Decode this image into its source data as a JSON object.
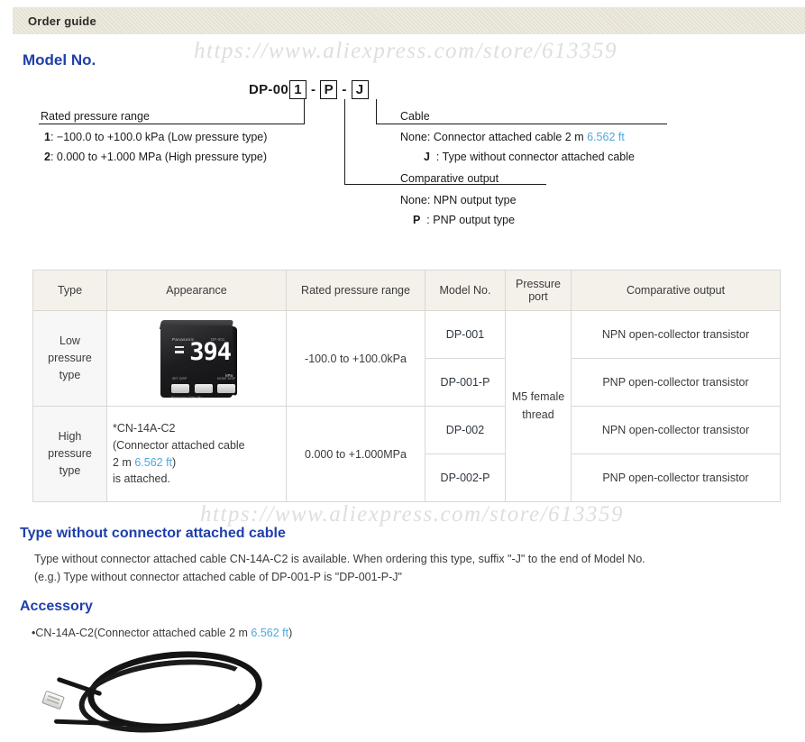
{
  "header": {
    "title": "Order guide"
  },
  "watermark": {
    "text": "https://www.aliexpress.com/store/613359"
  },
  "headings": {
    "model_no": "Model No.",
    "type_without_connector": "Type without connector attached cable",
    "accessory": "Accessory"
  },
  "model_code": {
    "prefix": "DP-00",
    "box1": "1",
    "box2": "P",
    "box3": "J",
    "dash": "-"
  },
  "legend": {
    "rated_pressure_range": {
      "title": "Rated pressure range",
      "items": [
        {
          "key": "1",
          "sep": ":",
          "text": "−100.0 to +100.0 kPa (Low pressure type)"
        },
        {
          "key": "2",
          "sep": ":",
          "text": "0.000 to +1.000 MPa (High pressure type)"
        }
      ]
    },
    "cable": {
      "title": "Cable",
      "items": [
        {
          "key": "None",
          "sep": ":",
          "text": "Connector attached cable 2 m ",
          "ft": "6.562 ft"
        },
        {
          "key": "J",
          "sep": ":",
          "text": "Type without connector attached cable",
          "ft": ""
        }
      ]
    },
    "comparative_output": {
      "title": "Comparative output",
      "items": [
        {
          "key": "None",
          "sep": ":",
          "text": "NPN output type"
        },
        {
          "key": "P",
          "sep": ":",
          "text": "PNP output type"
        }
      ]
    }
  },
  "table": {
    "columns": [
      "Type",
      "Appearance",
      "Rated pressure range",
      "Model No.",
      "Pressure port",
      "Comparative output"
    ],
    "column_pressure_port_line1": "Pressure",
    "column_pressure_port_line2": "port",
    "type_low": "Low pressure type",
    "type_high": "High pressure type",
    "appearance_note_line1": "*CN-14A-C2",
    "appearance_note_line2": "(Connector attached cable",
    "appearance_note_line3_pre": "2 m ",
    "appearance_note_line3_ft": "6.562 ft",
    "appearance_note_line3_post": ")",
    "appearance_note_line4": "is attached.",
    "range_low": "-100.0 to +100.0kPa",
    "range_high": "0.000 to +1.000MPa",
    "pressure_port": "M5 female thread",
    "rows": [
      {
        "model": "DP-001",
        "output": "NPN open-collector transistor"
      },
      {
        "model": "DP-001-P",
        "output": "PNP open-collector transistor"
      },
      {
        "model": "DP-002",
        "output": "NPN open-collector transistor"
      },
      {
        "model": "DP-002-P",
        "output": "PNP open-collector transistor"
      }
    ],
    "sensor_display": {
      "brand": "Panasonic",
      "model_label": "DP-001",
      "reading": "394",
      "unit": "kPa",
      "btn_left_label": "SET  DISP",
      "btn_mid_label": "MODE  DISP",
      "foot_label": "Panasonic    100%   kPa"
    }
  },
  "type_without_connector": {
    "line1": "Type without connector attached cable CN-14A-C2 is available. When ordering   this type, suffix \"-J\" to the end of Model No.",
    "line2": "(e.g.) Type without connector attached cable of DP-001-P is \"DP-001-P-J\""
  },
  "accessory": {
    "bullet": "•",
    "text_pre": "CN-14A-C2(Connector attached cable 2 m ",
    "text_ft": "6.562 ft",
    "text_post": ")"
  },
  "colors": {
    "heading_blue": "#1e3faa",
    "ft_blue": "#4ea8dd",
    "header_bar": "#e6e2d3",
    "table_header": "#f4f1ea",
    "type_cell": "#f7f7f7"
  }
}
